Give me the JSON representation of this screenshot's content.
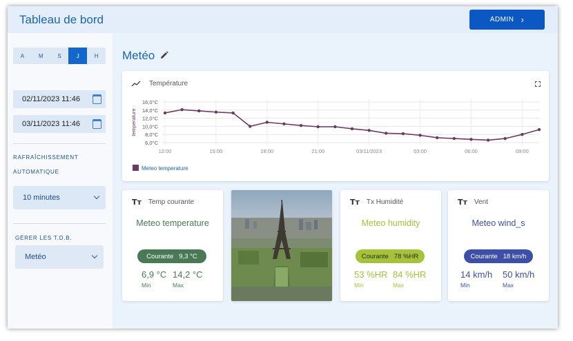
{
  "header": {
    "title": "Tableau de bord",
    "admin_label": "ADMIN",
    "admin_chevron": "›"
  },
  "sidebar": {
    "periods": [
      "A",
      "M",
      "S",
      "J",
      "H"
    ],
    "active_period": "J",
    "date_from": "02/11/2023 11:46",
    "date_to": "03/11/2023 11:46",
    "refresh_label_line1": "RAFRAÎCHISSEMENT",
    "refresh_label_line2": "AUTOMATIQUE",
    "refresh_value": "10 minutes",
    "manage_label": "GÉRER LES T.D.B.",
    "dashboard_value": "Metéo"
  },
  "main": {
    "title": "Metéo"
  },
  "chart_card": {
    "title": "Température"
  },
  "chart_data": {
    "type": "line",
    "ylabel": "temperature",
    "y_ticks": [
      "16,0°C",
      "14,0°C",
      "12,0°C",
      "10,0°C",
      "8,0°C",
      "6,0°C"
    ],
    "x_ticks": [
      "12:00",
      "15:00",
      "18:00",
      "21:00",
      "03/11/2023",
      "03:00",
      "06:00",
      "09:00"
    ],
    "ylim": [
      6,
      16
    ],
    "grid": true,
    "legend_position": "bottom-left",
    "series": [
      {
        "name": "Meteo temperature",
        "color": "#6b3a5e",
        "x_hours": [
          0,
          1,
          2,
          3,
          4,
          5,
          6,
          7,
          8,
          9,
          10,
          11,
          12,
          13,
          14,
          15,
          16,
          17,
          18,
          19,
          20,
          21,
          22
        ],
        "values": [
          13.3,
          14.1,
          13.8,
          13.5,
          13.3,
          10.0,
          11.0,
          10.6,
          10.2,
          9.9,
          9.9,
          9.4,
          9.0,
          8.3,
          8.2,
          7.8,
          7.2,
          7.0,
          6.8,
          6.6,
          7.0,
          8.0,
          9.2
        ]
      }
    ]
  },
  "cards": {
    "temp": {
      "head": "Temp courante",
      "sensor": "Meteo temperature",
      "current_label": "Courante",
      "current_value": "9,3 °C",
      "min_value": "6,9 °C",
      "min_label": "Min",
      "max_value": "14,2 °C",
      "max_label": "Max",
      "color": "#4a7a55"
    },
    "hum": {
      "head": "Tx Humidité",
      "sensor": "Meteo humidity",
      "current_label": "Courante",
      "current_value": "78 %HR",
      "min_value": "53 %HR",
      "min_label": "Min",
      "max_value": "84 %HR",
      "max_label": "Max",
      "color": "#a6c23a"
    },
    "wind": {
      "head": "Vent",
      "sensor": "Meteo wind_s",
      "current_label": "Courante",
      "current_value": "18 km/h",
      "min_value": "14 km/h",
      "min_label": "Min",
      "max_value": "50 km/h",
      "max_label": "Max",
      "color": "#3d4fa8"
    }
  },
  "icons": {
    "chart": "trending-line-icon",
    "text": "text-size-icon",
    "edit": "pencil-icon",
    "calendar": "calendar-icon",
    "expand": "fullscreen-icon"
  }
}
